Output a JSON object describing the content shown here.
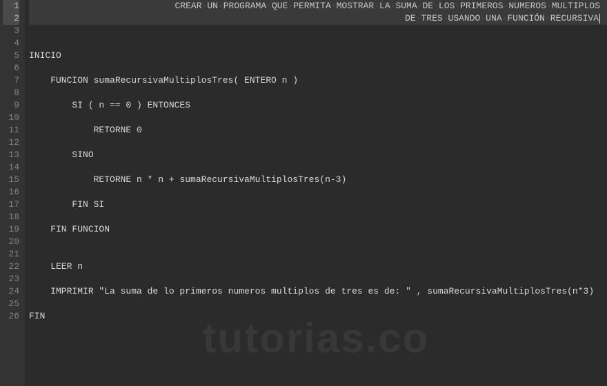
{
  "watermark": "tutorias.co",
  "lines": [
    {
      "num": 1,
      "hl": true,
      "indent": 0,
      "text": "",
      "comment_right": "CREAR·UN·PROGRAMA·QUE·PERMITA·MOSTRAR·LA·SUMA·DE·LOS·PRIMEROS·NUMEROS·MULTIPLOS"
    },
    {
      "num": 2,
      "hl": true,
      "indent": 0,
      "text": "",
      "comment_right": "DE·TRES·USANDO·UNA·FUNCIÓN·RECURSIVA",
      "caret": true
    },
    {
      "num": 3,
      "hl": false,
      "indent": 0,
      "text": ""
    },
    {
      "num": 4,
      "hl": false,
      "indent": 0,
      "text": ""
    },
    {
      "num": 5,
      "hl": false,
      "indent": 0,
      "text": "INICIO"
    },
    {
      "num": 6,
      "hl": false,
      "indent": 0,
      "text": ""
    },
    {
      "num": 7,
      "hl": false,
      "indent": 1,
      "text": "FUNCION sumaRecursivaMultiplosTres( ENTERO n )"
    },
    {
      "num": 8,
      "hl": false,
      "indent": 0,
      "text": ""
    },
    {
      "num": 9,
      "hl": false,
      "indent": 2,
      "text": "SI ( n == 0 ) ENTONCES"
    },
    {
      "num": 10,
      "hl": false,
      "indent": 0,
      "text": ""
    },
    {
      "num": 11,
      "hl": false,
      "indent": 3,
      "text": "RETORNE 0"
    },
    {
      "num": 12,
      "hl": false,
      "indent": 0,
      "text": ""
    },
    {
      "num": 13,
      "hl": false,
      "indent": 2,
      "text": "SINO"
    },
    {
      "num": 14,
      "hl": false,
      "indent": 0,
      "text": ""
    },
    {
      "num": 15,
      "hl": false,
      "indent": 3,
      "text": "RETORNE n * n + sumaRecursivaMultiplosTres(n-3)"
    },
    {
      "num": 16,
      "hl": false,
      "indent": 0,
      "text": ""
    },
    {
      "num": 17,
      "hl": false,
      "indent": 2,
      "text": "FIN SI"
    },
    {
      "num": 18,
      "hl": false,
      "indent": 0,
      "text": ""
    },
    {
      "num": 19,
      "hl": false,
      "indent": 1,
      "text": "FIN FUNCION"
    },
    {
      "num": 20,
      "hl": false,
      "indent": 0,
      "text": ""
    },
    {
      "num": 21,
      "hl": false,
      "indent": 0,
      "text": ""
    },
    {
      "num": 22,
      "hl": false,
      "indent": 1,
      "text": "LEER n"
    },
    {
      "num": 23,
      "hl": false,
      "indent": 0,
      "text": ""
    },
    {
      "num": 24,
      "hl": false,
      "indent": 1,
      "text": "IMPRIMIR \"La suma de lo primeros numeros multiplos de tres es de: \" , sumaRecursivaMultiplosTres(n*3)"
    },
    {
      "num": 25,
      "hl": false,
      "indent": 0,
      "text": ""
    },
    {
      "num": 26,
      "hl": false,
      "indent": 0,
      "text": "FIN"
    }
  ]
}
